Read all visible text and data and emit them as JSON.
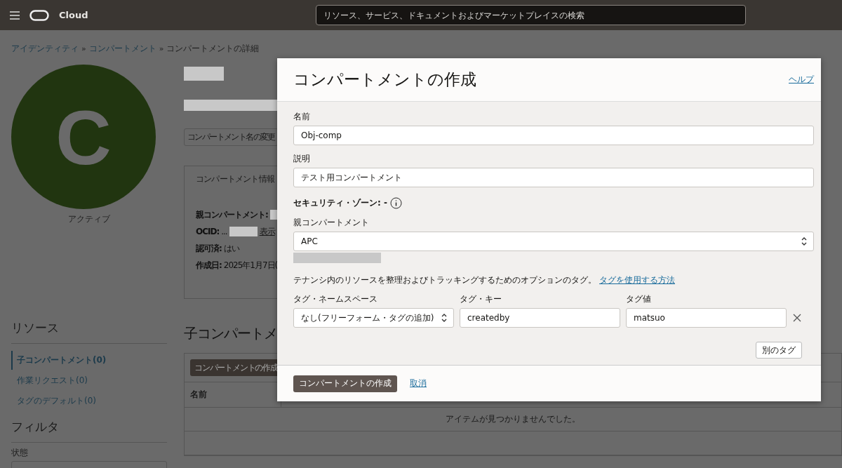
{
  "header": {
    "brand": "Cloud",
    "search_placeholder": "リソース、サービス、ドキュメントおよびマーケットプレイスの検索"
  },
  "breadcrumbs": {
    "separator": "»",
    "items": [
      {
        "label": "アイデンティティ",
        "kind": "link"
      },
      {
        "label": "コンパートメント",
        "kind": "link"
      },
      {
        "label": "コンパートメントの詳細",
        "kind": "current"
      }
    ]
  },
  "avatar": {
    "letter": "C",
    "status": "アクティブ"
  },
  "rename_button": "コンパートメント名の変更",
  "info_card": {
    "title": "コンパートメント情報",
    "fields": [
      {
        "label": "親コンパートメント:"
      },
      {
        "label": "OCID:",
        "value": "...",
        "link": "表示"
      },
      {
        "label": "認可済:",
        "value": "はい"
      },
      {
        "label": "作成日:",
        "value": "2025年1月7日("
      }
    ]
  },
  "resources": {
    "title": "リソース",
    "items": [
      {
        "label": "子コンパートメント(0)",
        "selected": true
      },
      {
        "label": "作業リクエスト(0)",
        "selected": false
      },
      {
        "label": "タグのデフォルト(0)",
        "selected": false
      }
    ]
  },
  "filter": {
    "title": "フィルタ",
    "state_label": "状態"
  },
  "child_section": {
    "title": "子コンパートメ",
    "create_button": "コンパートメントの作成",
    "columns": [
      "名前"
    ],
    "empty_message": "アイテムが見つかりませんでした。"
  },
  "dialog": {
    "title": "コンパートメントの作成",
    "help": "ヘルプ",
    "name": {
      "label": "名前",
      "value": "Obj-comp"
    },
    "description": {
      "label": "説明",
      "value": "テスト用コンパートメント"
    },
    "security_zone": "セキュリティ・ゾーン: -",
    "parent": {
      "label": "親コンパートメント",
      "value": "APC"
    },
    "tag_intro": "テナンシ内のリソースを整理およびトラッキングするためのオプションのタグ。",
    "tag_link": "タグを使用する方法",
    "tag_columns": [
      "タグ・ネームスペース",
      "タグ・キー",
      "タグ値"
    ],
    "tags": [
      {
        "namespace": "なし(フリーフォーム・タグの追加)",
        "key": "createdby",
        "value": "matsuo"
      }
    ],
    "add_tag": "別のタグ",
    "submit": "コンパートメントの作成",
    "cancel": "取消"
  }
}
